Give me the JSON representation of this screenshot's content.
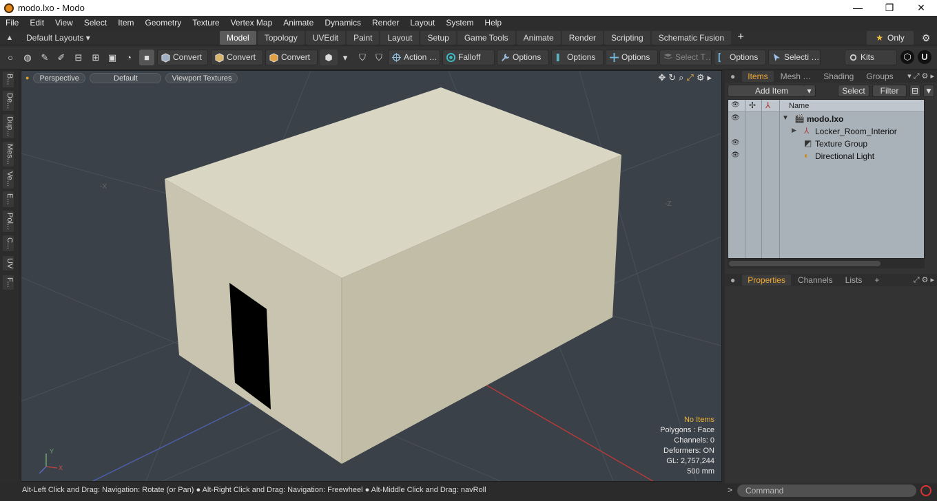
{
  "window": {
    "title": "modo.lxo - Modo",
    "controls": [
      "—",
      "❐",
      "✕"
    ]
  },
  "menu": [
    "File",
    "Edit",
    "View",
    "Select",
    "Item",
    "Geometry",
    "Texture",
    "Vertex Map",
    "Animate",
    "Dynamics",
    "Render",
    "Layout",
    "System",
    "Help"
  ],
  "layoutbar": {
    "layouts_label": "Default Layouts ▾",
    "tabs": [
      "Model",
      "Topology",
      "UVEdit",
      "Paint",
      "Layout",
      "Setup",
      "Game Tools",
      "Animate",
      "Render",
      "Scripting",
      "Schematic Fusion"
    ],
    "active_tab": "Model",
    "plus": "+",
    "only_label": "Only",
    "star": "★"
  },
  "toolbar": {
    "convert1": "Convert",
    "convert2": "Convert",
    "convert3": "Convert",
    "action": "Action …",
    "falloff": "Falloff",
    "options1": "Options",
    "options2": "Options",
    "options3": "Options",
    "select_t": "Select T…",
    "options4": "Options",
    "selecti": "Selecti …",
    "kits": "Kits"
  },
  "lefttabs": [
    "B...",
    "De...",
    "Dup...",
    "Mes...",
    "Ve...",
    "E...",
    "Pol...",
    "C...",
    "UV",
    "F..."
  ],
  "viewport": {
    "view_mode": "Perspective",
    "shading": "Default",
    "textures": "Viewport Textures",
    "axis_labels": {
      "neg_x": "-X",
      "neg_z": "-Z",
      "gizmo_y": "Y",
      "gizmo_x": "X"
    },
    "hud": {
      "no_items": "No Items",
      "polygons": "Polygons : Face",
      "channels": "Channels: 0",
      "deformers": "Deformers: ON",
      "gl": "GL: 2,757,244",
      "scale": "500 mm"
    }
  },
  "statusbar": "Alt-Left Click and Drag: Navigation: Rotate (or Pan) ● Alt-Right Click and Drag: Navigation: Freewheel ● Alt-Middle Click and Drag: navRoll",
  "items_panel": {
    "tabs": [
      "Items",
      "Mesh …",
      "Shading",
      "Groups"
    ],
    "active_tab": "Items",
    "add_item": "Add Item",
    "select": "Select",
    "filter": "Filter",
    "column_name": "Name",
    "tree": [
      {
        "name": "modo.lxo",
        "bold": true,
        "visible": true
      },
      {
        "name": "Locker_Room_Interior",
        "bold": false,
        "visible": false
      },
      {
        "name": "Texture Group",
        "bold": false,
        "visible": true
      },
      {
        "name": "Directional Light",
        "bold": false,
        "visible": true
      }
    ]
  },
  "properties_panel": {
    "tabs": [
      "Properties",
      "Channels",
      "Lists"
    ],
    "active_tab": "Properties",
    "plus": "+"
  },
  "command": {
    "prompt": ">",
    "placeholder": "Command"
  },
  "colors": {
    "accent": "#f0a830",
    "viewport_bg": "#3b4148",
    "box_light": "#d6d2c0",
    "box_dark": "#bab6a2"
  }
}
